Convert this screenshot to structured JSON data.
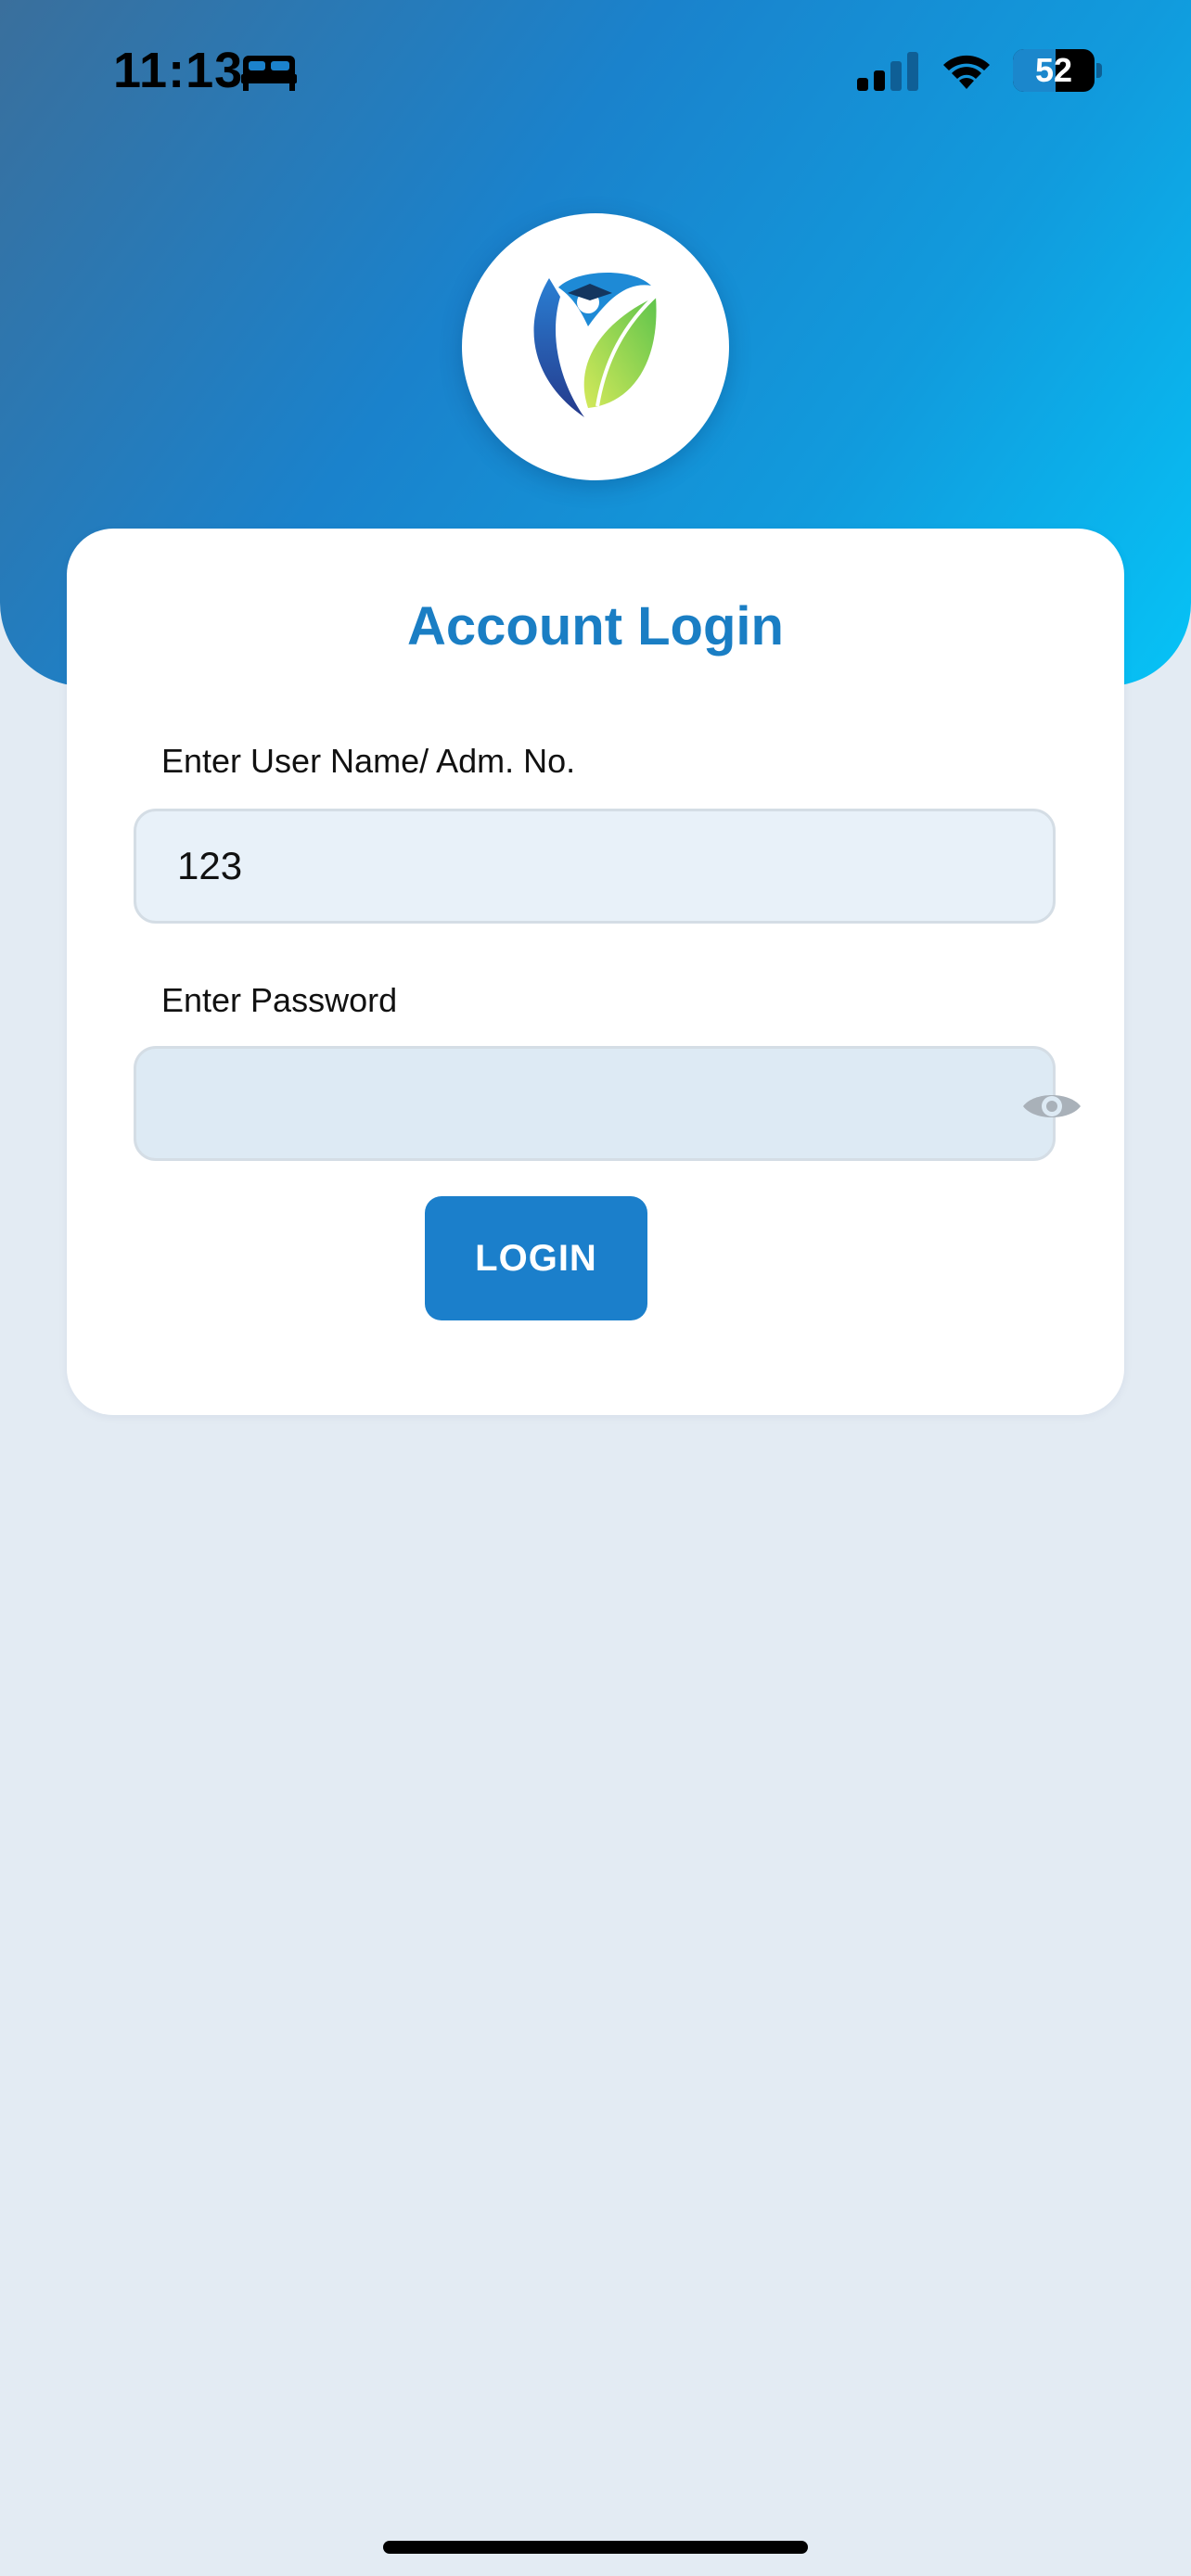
{
  "status_bar": {
    "time": "11:13",
    "focus_icon": "bed-icon",
    "signal_icon": "cellular-signal-icon",
    "wifi_icon": "wifi-icon",
    "battery_level": "52"
  },
  "logo": {
    "icon": "school-leaf-logo"
  },
  "login_card": {
    "title": "Account Login",
    "username_label": "Enter User Name/ Adm. No.",
    "username_value": "123",
    "password_label": "Enter Password",
    "password_value": "",
    "password_toggle_icon": "eye-icon",
    "login_button": "LOGIN"
  },
  "colors": {
    "header_gradient_start": "#3a6f9c",
    "header_gradient_end": "#06c3f6",
    "accent": "#1a7ec4",
    "page_background": "#e3ebf3"
  }
}
